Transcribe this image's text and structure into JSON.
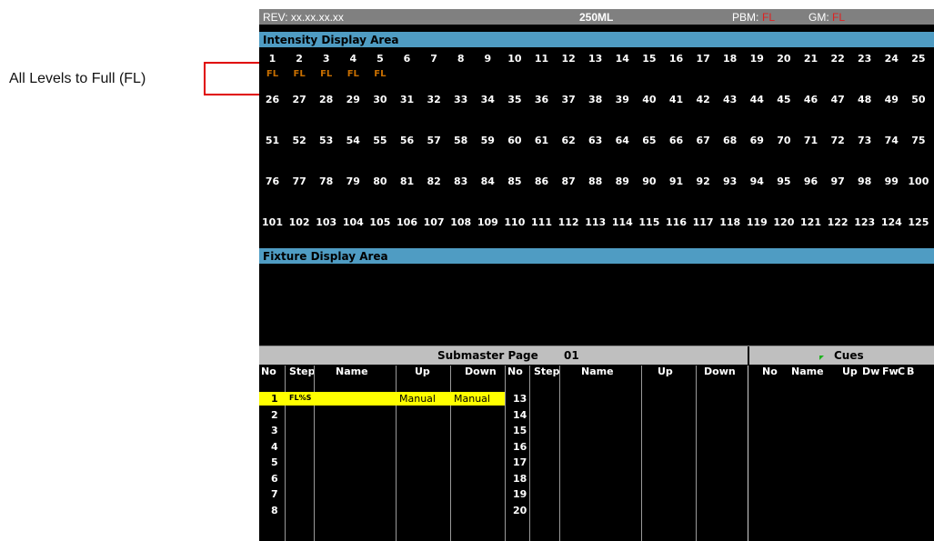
{
  "callout": {
    "label": "All Levels to Full (FL)"
  },
  "header": {
    "rev": "REV: xx.xx.xx.xx",
    "model": "250ML",
    "pbm_label": "PBM:",
    "pbm_value": "FL",
    "gm_label": "GM:",
    "gm_value": "FL"
  },
  "intensity": {
    "title": "Intensity Display Area",
    "rows": [
      [
        "1",
        "2",
        "3",
        "4",
        "5",
        "6",
        "7",
        "8",
        "9",
        "10",
        "11",
        "12",
        "13",
        "14",
        "15",
        "16",
        "17",
        "18",
        "19",
        "20",
        "21",
        "22",
        "23",
        "24",
        "25"
      ],
      [
        "26",
        "27",
        "28",
        "29",
        "30",
        "31",
        "32",
        "33",
        "34",
        "35",
        "36",
        "37",
        "38",
        "39",
        "40",
        "41",
        "42",
        "43",
        "44",
        "45",
        "46",
        "47",
        "48",
        "49",
        "50"
      ],
      [
        "51",
        "52",
        "53",
        "54",
        "55",
        "56",
        "57",
        "58",
        "59",
        "60",
        "61",
        "62",
        "63",
        "64",
        "65",
        "66",
        "67",
        "68",
        "69",
        "70",
        "71",
        "72",
        "73",
        "74",
        "75"
      ],
      [
        "76",
        "77",
        "78",
        "79",
        "80",
        "81",
        "82",
        "83",
        "84",
        "85",
        "86",
        "87",
        "88",
        "89",
        "90",
        "91",
        "92",
        "93",
        "94",
        "95",
        "96",
        "97",
        "98",
        "99",
        "100"
      ],
      [
        "101",
        "102",
        "103",
        "104",
        "105",
        "106",
        "107",
        "108",
        "109",
        "110",
        "111",
        "112",
        "113",
        "114",
        "115",
        "116",
        "117",
        "118",
        "119",
        "120",
        "121",
        "122",
        "123",
        "124",
        "125"
      ]
    ],
    "levels": [
      "FL",
      "FL",
      "FL",
      "FL",
      "FL"
    ]
  },
  "fixture": {
    "title": "Fixture Display Area"
  },
  "submaster": {
    "title": "Submaster Page",
    "page": "01",
    "columns": {
      "no": "No",
      "step": "Step",
      "name": "Name",
      "up": "Up",
      "down": "Down"
    },
    "left_rows": [
      "1",
      "2",
      "3",
      "4",
      "5",
      "6",
      "7",
      "8"
    ],
    "right_rows": [
      "13",
      "14",
      "15",
      "16",
      "17",
      "18",
      "19",
      "20"
    ],
    "row1": {
      "step": "FL%S",
      "up": "Manual",
      "down": "Manual"
    }
  },
  "cues": {
    "title": "Cues",
    "columns": [
      "No",
      "Name",
      "Up",
      "Dw",
      "Fw",
      "C",
      "B"
    ]
  },
  "colors": {
    "level_text": "#c86f00",
    "section_bar": "#4f9cc3",
    "highlight": "#ffff00",
    "header_value": "#e02020"
  }
}
